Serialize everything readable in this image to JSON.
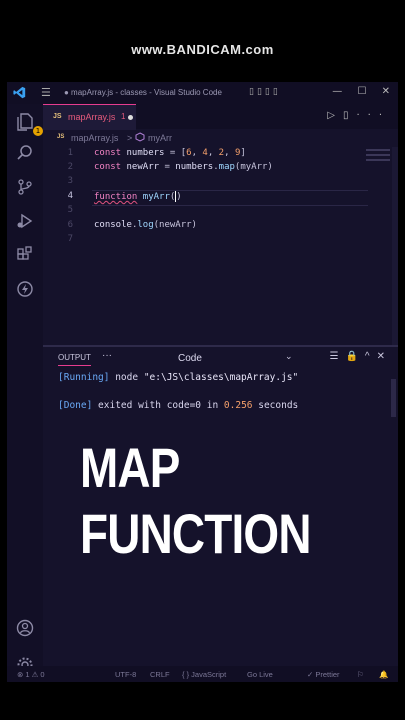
{
  "watermark": "www.BANDICAM.com",
  "window": {
    "title": "● mapArray.js - classes - Visual Studio Code",
    "menu_icon": "hamburger-menu-icon",
    "window_buttons": "— ☐ ✕"
  },
  "activity_bar": {
    "explorer_badge": "1",
    "icons": [
      "files-icon",
      "search-icon",
      "source-control-icon",
      "run-debug-icon",
      "extensions-icon",
      "lightning-icon",
      "account-icon",
      "gear-icon"
    ]
  },
  "tab": {
    "icon_label": "JS",
    "name": "mapArray.js",
    "problems": "1"
  },
  "breadcrumb": {
    "icon_label": "JS",
    "file": "mapArray.js",
    "separator": ">",
    "symbol": "myArr"
  },
  "editor": {
    "line_numbers": [
      "1",
      "2",
      "3",
      "4",
      "5",
      "6",
      "7"
    ],
    "lines": {
      "l1": {
        "kw": "const",
        "id": "numbers",
        "eq": " = [",
        "n1": "6",
        "n2": "4",
        "n3": "2",
        "n4": "9",
        "end": "]"
      },
      "l2": {
        "kw": "const",
        "id": "newArr",
        "eq": " = ",
        "obj": "numbers",
        "dot": ".",
        "fn": "map",
        "args": "(myArr)"
      },
      "l4": {
        "kw": "function",
        "name": "myArr",
        "paren_open": "(",
        "paren_close": ")"
      },
      "l6": {
        "obj": "console",
        "dot": ".",
        "fn": "log",
        "args": "(newArr)"
      }
    }
  },
  "panel": {
    "tab_label": "OUTPUT",
    "more": "···",
    "channel": "Code",
    "terminal": {
      "line1": {
        "tag": "[Running]",
        "text": " node ",
        "path": "\"e:\\JS\\classes\\mapArray.js\""
      },
      "line2": {
        "tag": "[Done]",
        "text1": " exited with ",
        "code": "code=0",
        "text2": " in ",
        "time": "0.256",
        "text3": " seconds"
      }
    }
  },
  "overlay": {
    "line1": "MAP",
    "line2": "FUNCTION"
  },
  "statusbar": {
    "errors": "⊗ 1 ⚠ 0",
    "encoding": "UTF-8",
    "eol": "CRLF",
    "language": "{ } JavaScript",
    "golive": "Go Live",
    "prettier": "✓ Prettier"
  },
  "colors": {
    "accent": "#e63c8f",
    "editor_bg": "#15122b",
    "keyword": "#f283c4",
    "function": "#a0d7ff",
    "number": "#f5a06b",
    "terminal_tag": "#69a8f5"
  }
}
